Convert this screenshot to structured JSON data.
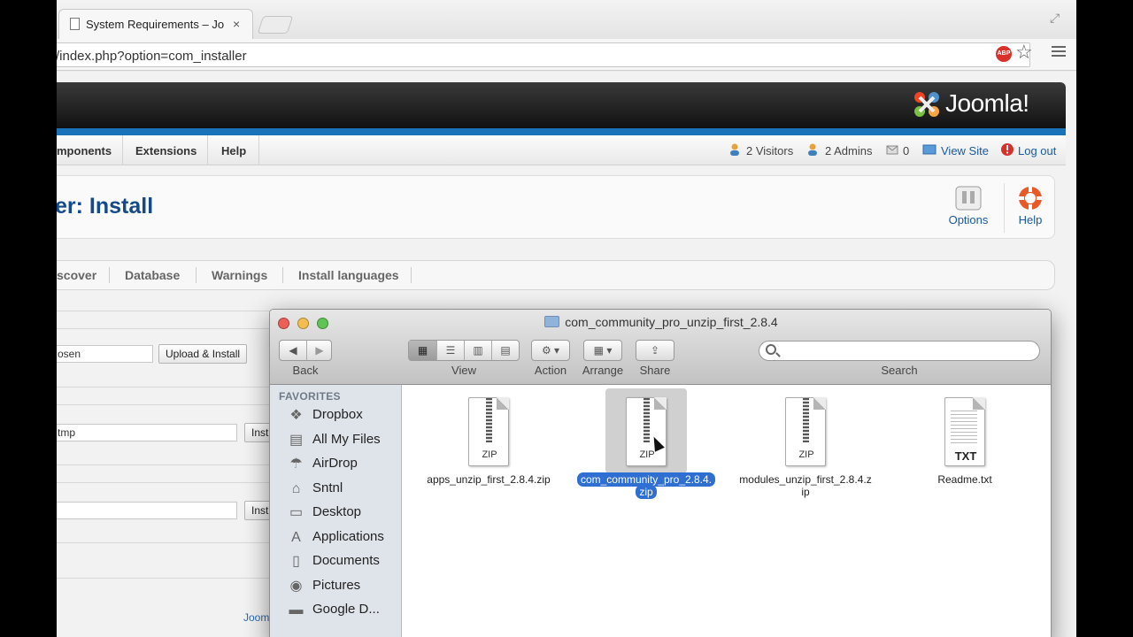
{
  "browser": {
    "tab_title": "System Requirements – Jo",
    "tab_close": "×",
    "url": "/index.php?option=com_installer",
    "abp_label": "ABP"
  },
  "joomla": {
    "brand": "Joomla!",
    "menu": [
      "mponents",
      "Extensions",
      "Help"
    ],
    "status": {
      "visitors": "2 Visitors",
      "admins": "2 Admins",
      "messages": "0",
      "view_site": "View Site",
      "logout": "Log out"
    },
    "page_title": "er: Install",
    "toolbar": {
      "options": "Options",
      "help": "Help"
    },
    "subtabs": [
      "scover",
      "Database",
      "Warnings",
      "Install languages"
    ],
    "form": {
      "upload_value": "osen",
      "upload_button": "Upload & Install",
      "dir_value": "tmp",
      "dir_button": "Inst",
      "url_button": "Inst"
    },
    "footer_link": "Joom"
  },
  "finder": {
    "title": "com_community_pro_unzip_first_2.8.4",
    "toolbar_labels": {
      "back": "Back",
      "view": "View",
      "action": "Action",
      "arrange": "Arrange",
      "share": "Share",
      "search": "Search"
    },
    "sidebar_heading": "FAVORITES",
    "sidebar_items": [
      {
        "label": "Dropbox",
        "icon": "dropbox-icon",
        "glyph": "❖"
      },
      {
        "label": "All My Files",
        "icon": "all-files-icon",
        "glyph": "▤"
      },
      {
        "label": "AirDrop",
        "icon": "airdrop-icon",
        "glyph": "☂"
      },
      {
        "label": "Sntnl",
        "icon": "home-icon",
        "glyph": "⌂"
      },
      {
        "label": "Desktop",
        "icon": "desktop-icon",
        "glyph": "▭"
      },
      {
        "label": "Applications",
        "icon": "applications-icon",
        "glyph": "A"
      },
      {
        "label": "Documents",
        "icon": "documents-icon",
        "glyph": "▯"
      },
      {
        "label": "Pictures",
        "icon": "pictures-icon",
        "glyph": "◉"
      },
      {
        "label": "Google D...",
        "icon": "folder-icon",
        "glyph": "▬"
      }
    ],
    "files": [
      {
        "name": "apps_unzip_first_2.8.4.zip",
        "type": "ZIP",
        "selected": false
      },
      {
        "name": "com_community_pro_2.8.4.zip",
        "type": "ZIP",
        "selected": true
      },
      {
        "name": "modules_unzip_first_2.8.4.zip",
        "type": "ZIP",
        "selected": false
      },
      {
        "name": "Readme.txt",
        "type": "TXT",
        "selected": false
      }
    ],
    "file_label_lines": [
      [
        "apps_unzip_first_2.8.4.zip"
      ],
      [
        "com_community_pro_2.8.4.",
        "zip"
      ],
      [
        "modules_unzip_first_2.8.4.z",
        "ip"
      ],
      [
        "Readme.txt"
      ]
    ]
  },
  "colors": {
    "joomla_blue": "#1a73b8",
    "selection": "#2f6fd1",
    "title_blue": "#154a8a"
  }
}
